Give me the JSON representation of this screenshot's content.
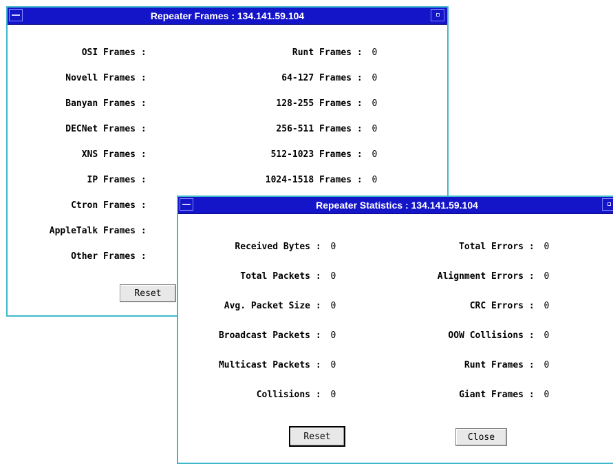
{
  "frames_window": {
    "title": "Repeater Frames : 134.141.59.104",
    "left_rows": [
      {
        "label": "OSI Frames",
        "value": ""
      },
      {
        "label": "Novell Frames",
        "value": ""
      },
      {
        "label": "Banyan Frames",
        "value": ""
      },
      {
        "label": "DECNet Frames",
        "value": ""
      },
      {
        "label": "XNS Frames",
        "value": ""
      },
      {
        "label": "IP Frames",
        "value": ""
      },
      {
        "label": "Ctron Frames",
        "value": ""
      },
      {
        "label": "AppleTalk Frames",
        "value": ""
      },
      {
        "label": "Other Frames",
        "value": ""
      }
    ],
    "right_rows": [
      {
        "label": "Runt Frames",
        "value": "0"
      },
      {
        "label": "64-127 Frames",
        "value": "0"
      },
      {
        "label": "128-255 Frames",
        "value": "0"
      },
      {
        "label": "256-511 Frames",
        "value": "0"
      },
      {
        "label": "512-1023 Frames",
        "value": "0"
      },
      {
        "label": "1024-1518 Frames",
        "value": "0"
      }
    ],
    "reset_label": "Reset"
  },
  "stats_window": {
    "title": "Repeater Statistics : 134.141.59.104",
    "left_rows": [
      {
        "label": "Received Bytes",
        "value": "0"
      },
      {
        "label": "Total Packets",
        "value": "0"
      },
      {
        "label": "Avg. Packet Size",
        "value": "0"
      },
      {
        "label": "Broadcast Packets",
        "value": "0"
      },
      {
        "label": "Multicast Packets",
        "value": "0"
      },
      {
        "label": "Collisions",
        "value": "0"
      }
    ],
    "right_rows": [
      {
        "label": "Total Errors",
        "value": "0"
      },
      {
        "label": "Alignment Errors",
        "value": "0"
      },
      {
        "label": "CRC Errors",
        "value": "0"
      },
      {
        "label": "OOW Collisions",
        "value": "0"
      },
      {
        "label": "Runt Frames",
        "value": "0"
      },
      {
        "label": "Giant Frames",
        "value": "0"
      }
    ],
    "reset_label": "Reset",
    "close_label": "Close"
  },
  "colors": {
    "titlebar": "#1414c8",
    "window_border": "#3fb8cc",
    "title_text": "#ffffff"
  },
  "icons": [
    "window-menu-icon",
    "maximize-icon"
  ]
}
